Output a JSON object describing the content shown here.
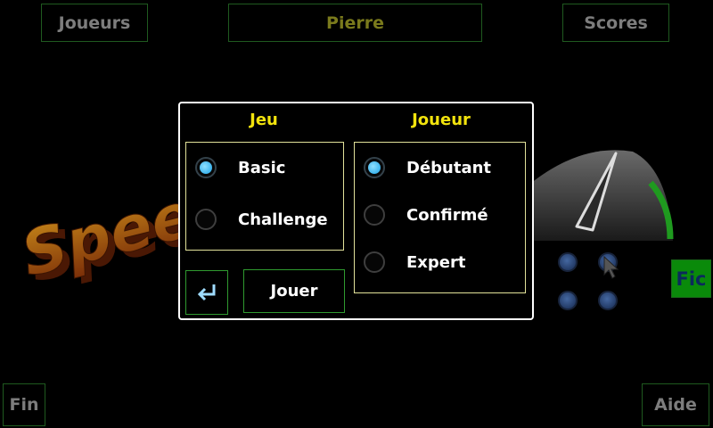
{
  "top": {
    "players": "Joueurs",
    "current_player": "Pierre",
    "scores": "Scores"
  },
  "bottom": {
    "end": "Fin",
    "help": "Aide"
  },
  "side": {
    "fic": "Fic"
  },
  "logo": {
    "text": "Speed"
  },
  "dialog": {
    "game": {
      "heading": "Jeu",
      "options": [
        {
          "label": "Basic",
          "selected": true
        },
        {
          "label": "Challenge",
          "selected": false
        }
      ]
    },
    "player": {
      "heading": "Joueur",
      "options": [
        {
          "label": "Débutant",
          "selected": true
        },
        {
          "label": "Confirmé",
          "selected": false
        },
        {
          "label": "Expert",
          "selected": false
        }
      ]
    },
    "play_label": "Jouer",
    "back_icon": "return-arrow-icon"
  },
  "colors": {
    "background": "#000000",
    "heading": "#f2e30d",
    "player_name": "#7a7a1c",
    "radio_on": "#1aa2e6",
    "button_border": "#2f9a2f",
    "gauge_green": "#1f9a1f"
  }
}
